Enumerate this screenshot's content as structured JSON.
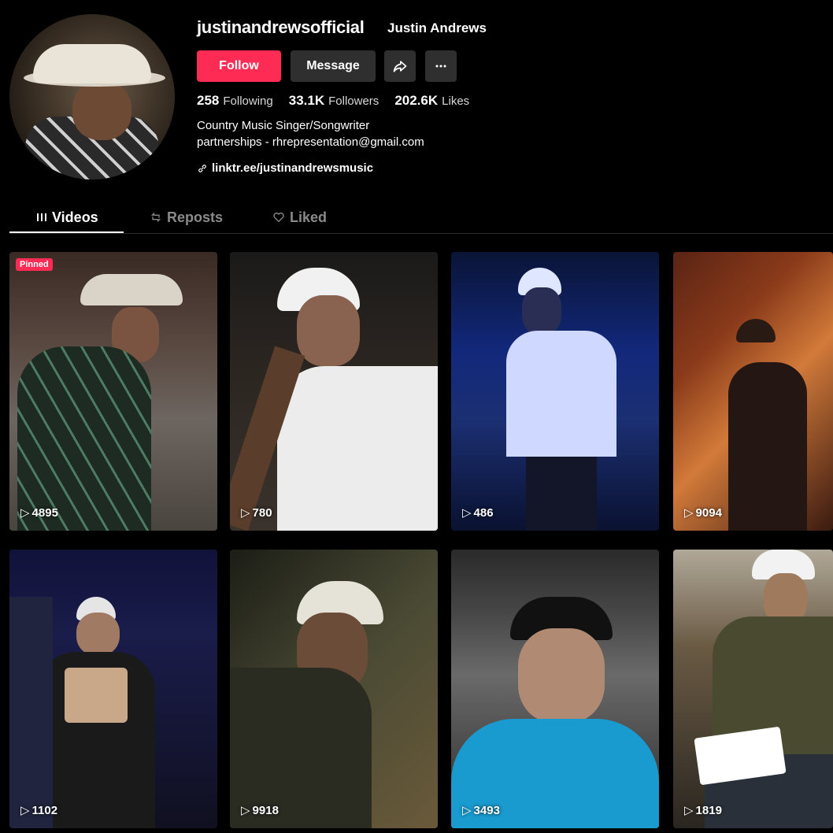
{
  "profile": {
    "username": "justinandrewsofficial",
    "display_name": "Justin Andrews",
    "follow_label": "Follow",
    "message_label": "Message",
    "stats": [
      {
        "value": "258",
        "label": "Following"
      },
      {
        "value": "33.1K",
        "label": "Followers"
      },
      {
        "value": "202.6K",
        "label": "Likes"
      }
    ],
    "bio_line1": "Country Music Singer/Songwriter",
    "bio_line2": "partnerships - rhrepresentation@gmail.com",
    "link": "linktr.ee/justinandrewsmusic"
  },
  "tabs": [
    {
      "label": "Videos",
      "icon": "grid-icon",
      "active": true
    },
    {
      "label": "Reposts",
      "icon": "repost-icon",
      "active": false
    },
    {
      "label": "Liked",
      "icon": "heart-icon",
      "active": false
    }
  ],
  "videos": [
    {
      "views": "4895",
      "pinned_label": "Pinned"
    },
    {
      "views": "780"
    },
    {
      "views": "486"
    },
    {
      "views": "9094"
    },
    {
      "views": "1102"
    },
    {
      "views": "9918"
    },
    {
      "views": "3493"
    },
    {
      "views": "1819"
    }
  ],
  "colors": {
    "accent": "#fe2c55",
    "button_dark": "#2f2f2f",
    "background": "#000000"
  }
}
